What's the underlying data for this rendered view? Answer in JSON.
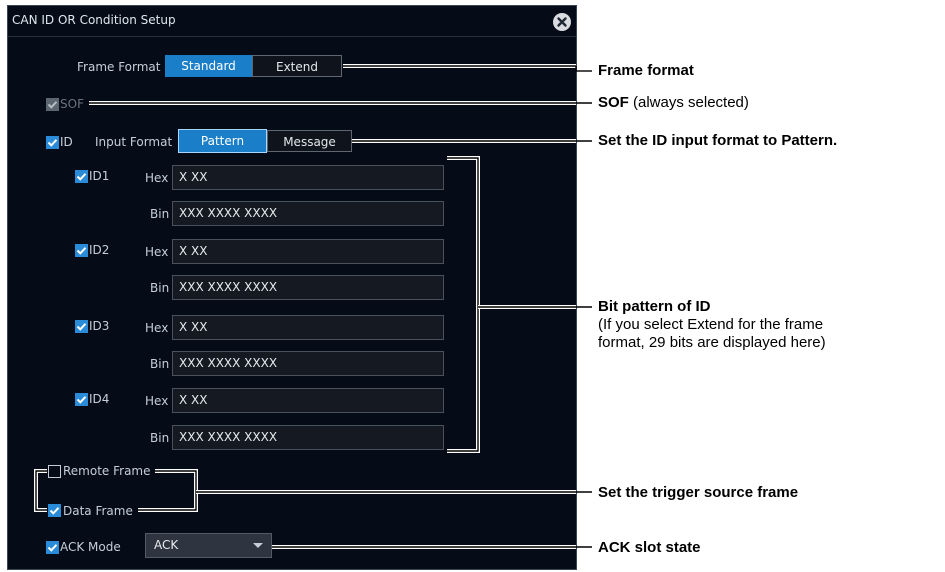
{
  "dialog": {
    "title": "CAN ID OR Condition Setup",
    "close_icon": "close-circle-icon"
  },
  "frame_format": {
    "label": "Frame Format",
    "options": [
      "Standard",
      "Extend"
    ],
    "selected": "Standard"
  },
  "sof": {
    "label": "SOF",
    "checked": true,
    "disabled": true
  },
  "id": {
    "label": "ID",
    "checked": true,
    "input_format_label": "Input Format",
    "input_format_options": [
      "Pattern",
      "Message"
    ],
    "input_format_selected": "Pattern",
    "entries": [
      {
        "label": "ID1",
        "checked": true,
        "hex_label": "Hex",
        "hex": "X XX",
        "bin_label": "Bin",
        "bin": "XXX XXXX XXXX"
      },
      {
        "label": "ID2",
        "checked": true,
        "hex_label": "Hex",
        "hex": "X XX",
        "bin_label": "Bin",
        "bin": "XXX XXXX XXXX"
      },
      {
        "label": "ID3",
        "checked": true,
        "hex_label": "Hex",
        "hex": "X XX",
        "bin_label": "Bin",
        "bin": "XXX XXXX XXXX"
      },
      {
        "label": "ID4",
        "checked": true,
        "hex_label": "Hex",
        "hex": "X XX",
        "bin_label": "Bin",
        "bin": "XXX XXXX XXXX"
      }
    ]
  },
  "frames": {
    "remote_frame": {
      "label": "Remote Frame",
      "checked": false
    },
    "data_frame": {
      "label": "Data Frame",
      "checked": true
    }
  },
  "ack_mode": {
    "label": "ACK Mode",
    "checked": true,
    "value": "ACK"
  },
  "callouts": {
    "frame_format": "Frame format",
    "sof_bold": "SOF",
    "sof_note": " (always selected)",
    "id_input_format": "Set the ID input format to Pattern.",
    "bit_pattern_title": "Bit pattern of ID",
    "bit_pattern_note_1": "(If you select Extend for the frame",
    "bit_pattern_note_2": "format, 29 bits are displayed here)",
    "trigger_source": "Set the trigger source frame",
    "ack_slot": "ACK slot state"
  },
  "colors": {
    "panel_bg": "#060c17",
    "accent_blue": "#1a7ec8",
    "checkbox_blue": "#2a8cd8"
  }
}
